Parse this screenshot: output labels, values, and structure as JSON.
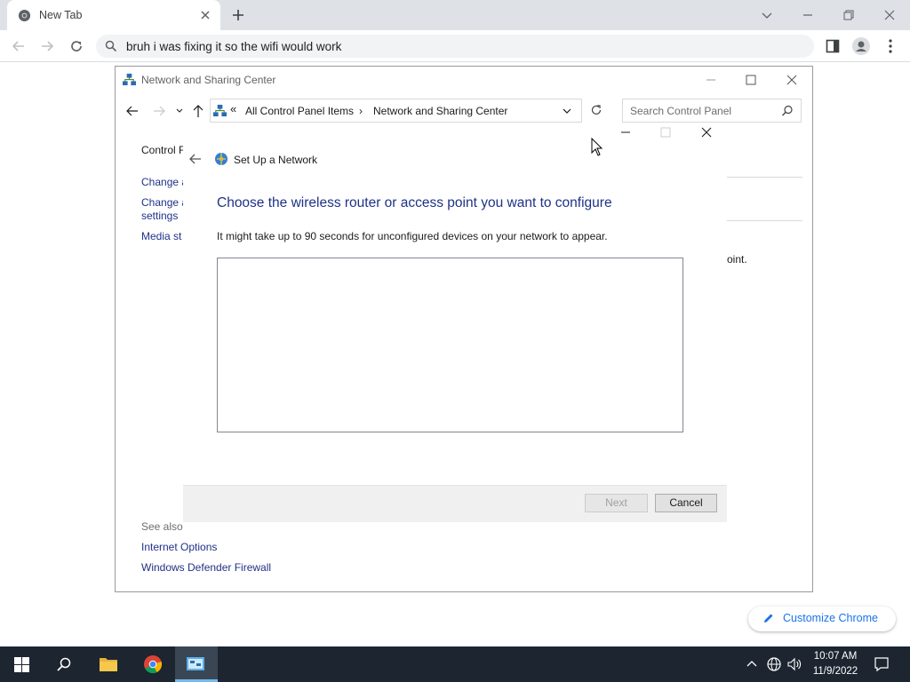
{
  "browser": {
    "tab_title": "New Tab",
    "omnibox_text": "bruh i was fixing it so the wifi would work",
    "customize_label": "Customize Chrome"
  },
  "control_panel": {
    "window_title": "Network and Sharing Center",
    "breadcrumb": [
      "All Control Panel Items",
      "Network and Sharing Center"
    ],
    "breadcrumb_overflow": "«",
    "search_placeholder": "Search Control Panel",
    "sidebar": {
      "home": "Control F",
      "change_adapter": "Change a",
      "change_sharing_1": "Change a",
      "change_sharing_2": "settings",
      "media": "Media st"
    },
    "right_fragment": "oint.",
    "see_also_header": "See also",
    "see_also": [
      "Internet Options",
      "Windows Defender Firewall"
    ]
  },
  "dialog": {
    "title": "Set Up a Network",
    "heading": "Choose the wireless router or access point you want to configure",
    "description": "It might take up to 90 seconds for unconfigured devices on your network to appear.",
    "next_label": "Next",
    "cancel_label": "Cancel",
    "next_enabled": false
  },
  "taskbar": {
    "time": "10:07 AM",
    "date": "11/9/2022"
  },
  "icons": [
    "chrome-favicon-icon",
    "close-icon",
    "plus-icon",
    "chevron-down-icon",
    "minimize-icon",
    "restore-icon",
    "back-arrow-icon",
    "forward-arrow-icon",
    "reload-icon",
    "search-icon",
    "sidebar-icon",
    "profile-icon",
    "kebab-menu-icon",
    "network-icon",
    "up-arrow-icon",
    "refresh-icon",
    "pencil-icon",
    "windows-start-icon",
    "taskbar-search-icon",
    "file-explorer-icon",
    "chrome-icon",
    "control-panel-icon",
    "chevron-up-icon",
    "globe-icon",
    "volume-icon",
    "notification-icon"
  ],
  "colors": {
    "link": "#1e3287",
    "taskbar": "#1c2530",
    "accent": "#1a73e8"
  }
}
